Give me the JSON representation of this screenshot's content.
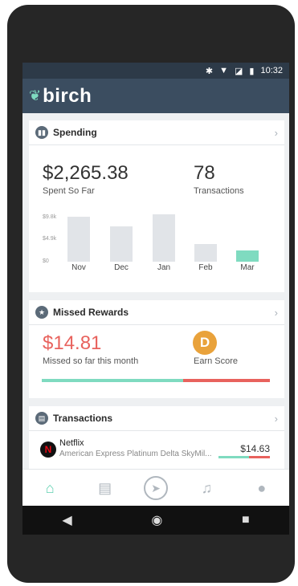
{
  "status": {
    "icons": [
      "bluetooth-icon",
      "wifi-icon",
      "signal-icon",
      "battery-icon"
    ],
    "time": "10:32"
  },
  "app": {
    "name": "birch",
    "accent": "#7fdbc0",
    "header_color": "#3b4d60"
  },
  "spending": {
    "title": "Spending",
    "amount": "$2,265.38",
    "amount_label": "Spent So Far",
    "transactions_count": "78",
    "transactions_label": "Transactions",
    "y_ticks": [
      "$9.8k",
      "$4.9k",
      "$0"
    ],
    "chart_data": {
      "type": "bar",
      "categories": [
        "Nov",
        "Dec",
        "Jan",
        "Feb",
        "Mar"
      ],
      "values": [
        8600,
        6800,
        9000,
        3400,
        2000
      ],
      "ylim": [
        0,
        9800
      ],
      "highlight": "Mar"
    }
  },
  "missed_rewards": {
    "title": "Missed Rewards",
    "amount": "$14.81",
    "amount_label": "Missed so far this month",
    "score_letter": "D",
    "score_label": "Earn Score",
    "progress_good": 0.62
  },
  "transactions": {
    "title": "Transactions",
    "items": [
      {
        "merchant": "Netflix",
        "card": "American Express Platinum Delta SkyMil...",
        "amount": "$14.63"
      }
    ]
  },
  "nav": [
    "home-icon",
    "wallet-icon",
    "navigation-icon",
    "bell-icon",
    "profile-icon"
  ]
}
